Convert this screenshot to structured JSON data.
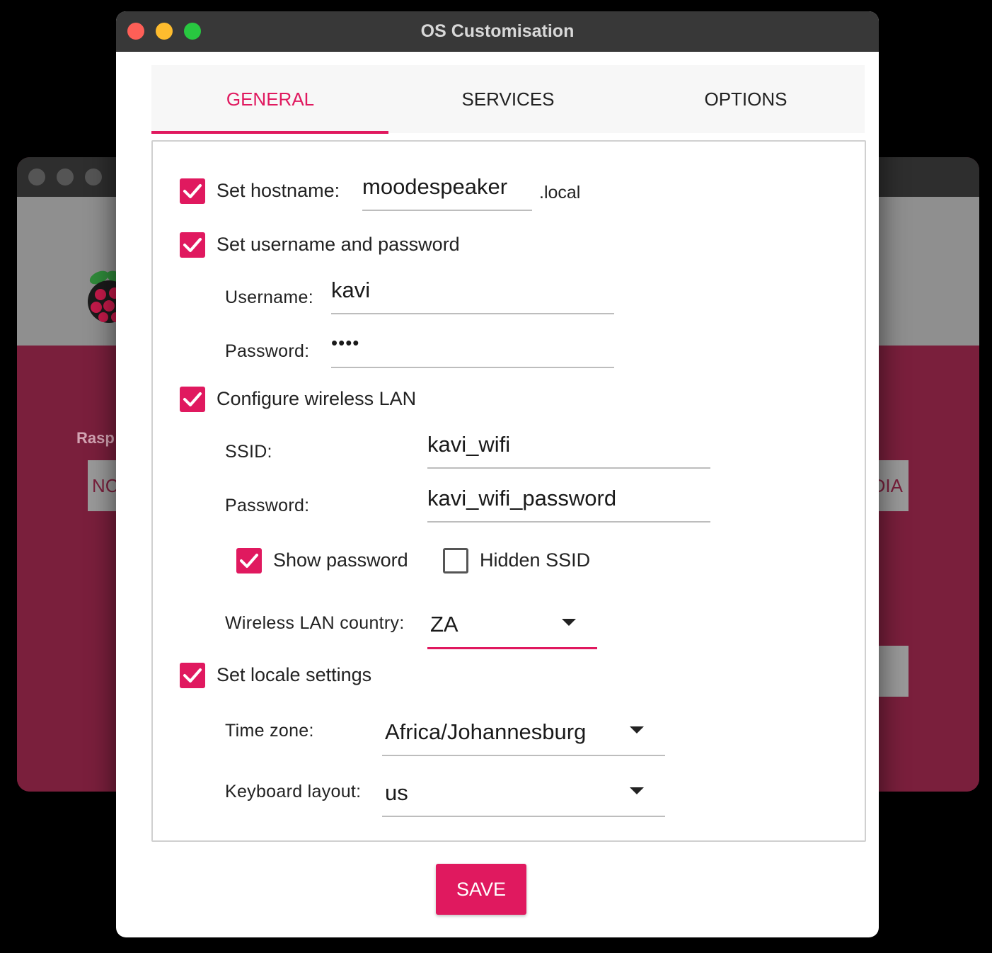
{
  "background_window": {
    "label_partial": "Rasp",
    "button_left_partial": "NC",
    "button_right_partial": "DIA"
  },
  "window": {
    "title": "OS Customisation"
  },
  "tabs": [
    {
      "label": "GENERAL",
      "active": true
    },
    {
      "label": "SERVICES",
      "active": false
    },
    {
      "label": "OPTIONS",
      "active": false
    }
  ],
  "general": {
    "hostname": {
      "label": "Set hostname:",
      "value": "moodespeaker",
      "suffix": ".local",
      "checked": true
    },
    "user": {
      "label": "Set username and password",
      "checked": true,
      "username_label": "Username:",
      "username_value": "kavi",
      "password_label": "Password:",
      "password_value": "••••"
    },
    "wlan": {
      "label": "Configure wireless LAN",
      "checked": true,
      "ssid_label": "SSID:",
      "ssid_value": "kavi_wifi",
      "password_label": "Password:",
      "password_value": "kavi_wifi_password",
      "show_password_label": "Show password",
      "show_password_checked": true,
      "hidden_ssid_label": "Hidden SSID",
      "hidden_ssid_checked": false,
      "country_label": "Wireless LAN country:",
      "country_value": "ZA"
    },
    "locale": {
      "label": "Set locale settings",
      "checked": true,
      "timezone_label": "Time zone:",
      "timezone_value": "Africa/Johannesburg",
      "keyboard_label": "Keyboard layout:",
      "keyboard_value": "us"
    }
  },
  "save_label": "SAVE",
  "colors": {
    "accent": "#e0195f",
    "titlebar": "#383838",
    "background_window": "#7a1f3c"
  }
}
